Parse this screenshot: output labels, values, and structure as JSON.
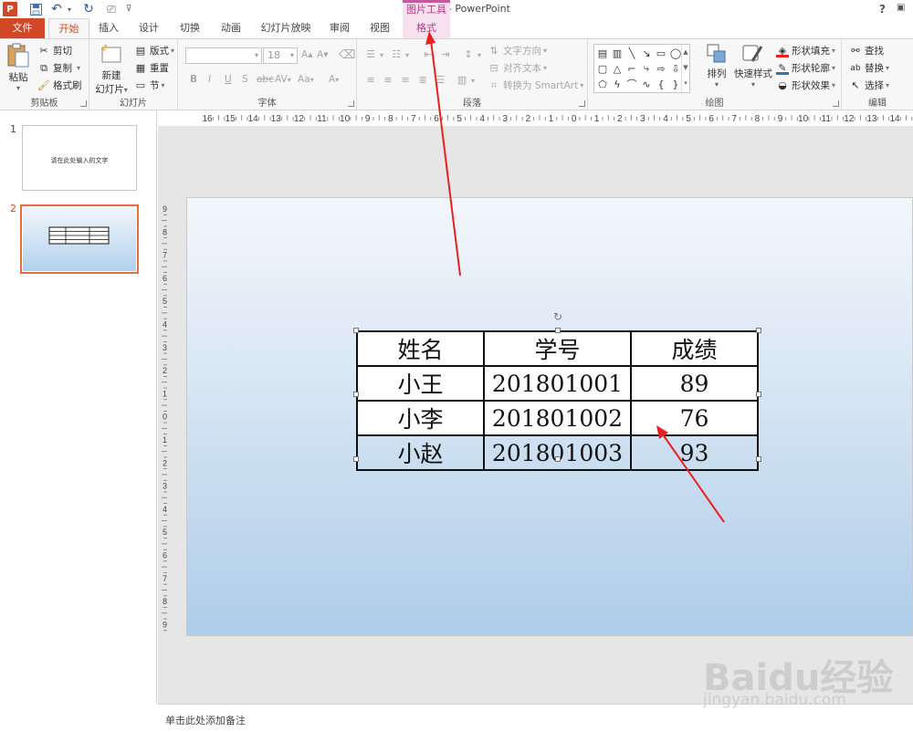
{
  "window": {
    "title": "ppt2013 - PowerPoint",
    "context_group": "图片工具",
    "help": "?"
  },
  "tabs": [
    "文件",
    "开始",
    "插入",
    "设计",
    "切换",
    "动画",
    "幻灯片放映",
    "审阅",
    "视图",
    "格式"
  ],
  "ribbon": {
    "clipboard": {
      "label": "剪贴板",
      "paste": "粘贴",
      "cut": "剪切",
      "copy": "复制",
      "format_painter": "格式刷"
    },
    "slides": {
      "label": "幻灯片",
      "new_slide_line1": "新建",
      "new_slide_line2": "幻灯片",
      "layout": "版式",
      "reset": "重置",
      "section": "节"
    },
    "font": {
      "label": "字体",
      "font_name": "",
      "font_size": "18",
      "bold": "B",
      "italic": "I",
      "underline": "U",
      "shadow": "S",
      "strike": "abc",
      "spacing": "AV",
      "case": "Aa",
      "color": "A"
    },
    "paragraph": {
      "label": "段落",
      "text_direction": "文字方向",
      "align_text": "对齐文本",
      "smartart": "转换为 SmartArt"
    },
    "drawing": {
      "label": "绘图",
      "arrange": "排列",
      "quick_styles": "快速样式",
      "shape_fill": "形状填充",
      "shape_outline": "形状轮廓",
      "shape_effects": "形状效果"
    },
    "editing": {
      "label": "编辑",
      "find": "查找",
      "replace": "替换",
      "select": "选择"
    }
  },
  "thumbnails": [
    {
      "number": "1",
      "title": "",
      "caption": "请在此处输入的文字"
    },
    {
      "number": "2"
    }
  ],
  "ruler": {
    "horizontal": [
      "16",
      "15",
      "14",
      "13",
      "12",
      "11",
      "10",
      "9",
      "8",
      "7",
      "6",
      "5",
      "4",
      "3",
      "2",
      "1",
      "0",
      "1",
      "2",
      "3",
      "4",
      "5",
      "6",
      "7",
      "8",
      "9",
      "10",
      "11",
      "12",
      "13",
      "14"
    ],
    "vertical": [
      "9",
      "8",
      "7",
      "6",
      "5",
      "4",
      "3",
      "2",
      "1",
      "0",
      "1",
      "2",
      "3",
      "4",
      "5",
      "6",
      "7",
      "8",
      "9"
    ]
  },
  "table": {
    "headers": [
      "姓名",
      "学号",
      "成绩"
    ],
    "rows": [
      [
        "小王",
        "201801001",
        "89"
      ],
      [
        "小李",
        "201801002",
        "76"
      ],
      [
        "小赵",
        "201801003",
        "93"
      ]
    ]
  },
  "notes_placeholder": "单击此处添加备注",
  "watermark": {
    "logo": "Baidu经验",
    "site": "jingyan.baidu.com"
  },
  "colors": {
    "accent": "#d24726",
    "context_tab": "#b53d87",
    "arrow": "#e8211f"
  }
}
